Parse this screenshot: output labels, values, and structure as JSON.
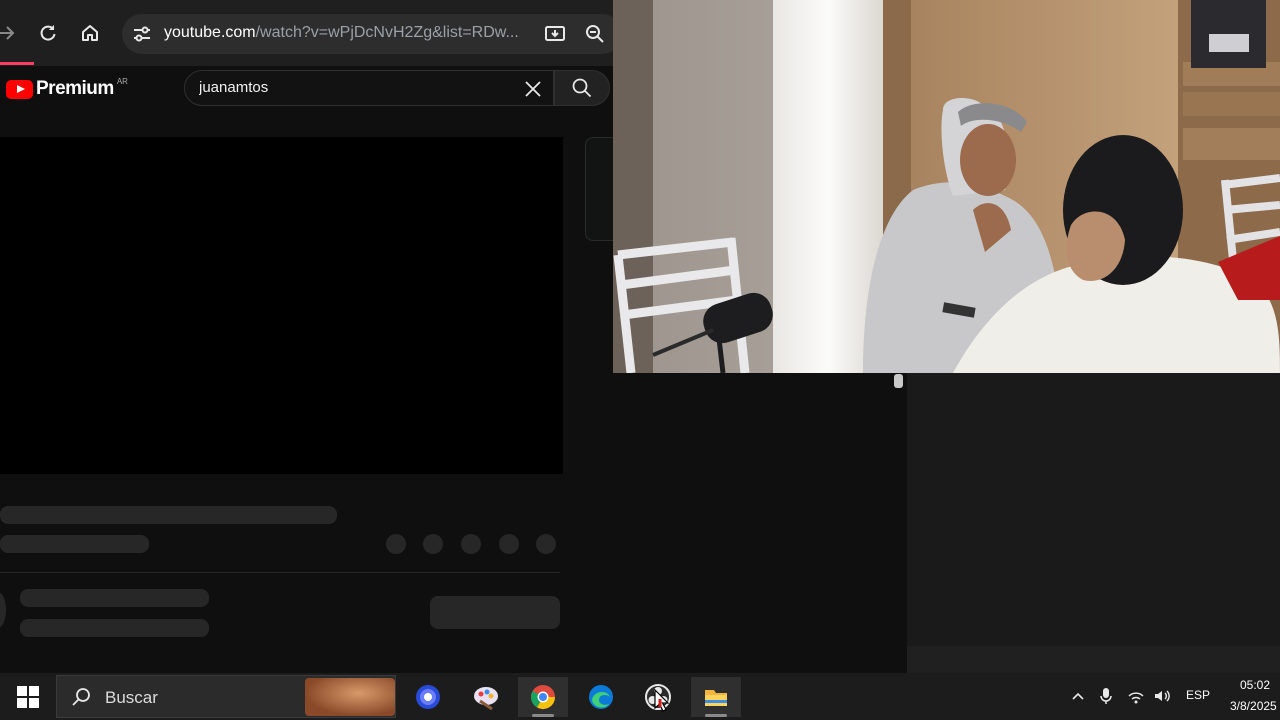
{
  "browser": {
    "url_host": "youtube.com",
    "url_rest": "/watch?v=wPjDcNvH2Zg&list=RDw...",
    "icons": [
      "forward-icon",
      "reload-icon",
      "home-icon",
      "site-settings-icon",
      "install-app-icon",
      "zoom-icon"
    ]
  },
  "youtube": {
    "logo_text": "Premium",
    "country_code": "AR",
    "search_value": "juanamtos",
    "colors": {
      "brand": "#ff0000",
      "background": "#0f0f0f",
      "skeleton": "#272727"
    }
  },
  "taskbar": {
    "search_placeholder": "Buscar",
    "apps": [
      "start-icon",
      "assistant-app-icon",
      "paint-app-icon",
      "chrome-icon",
      "edge-icon",
      "obs-icon",
      "file-explorer-icon"
    ],
    "tray": {
      "language": "ESP",
      "time": "05:02",
      "date": "3/8/2025"
    }
  }
}
